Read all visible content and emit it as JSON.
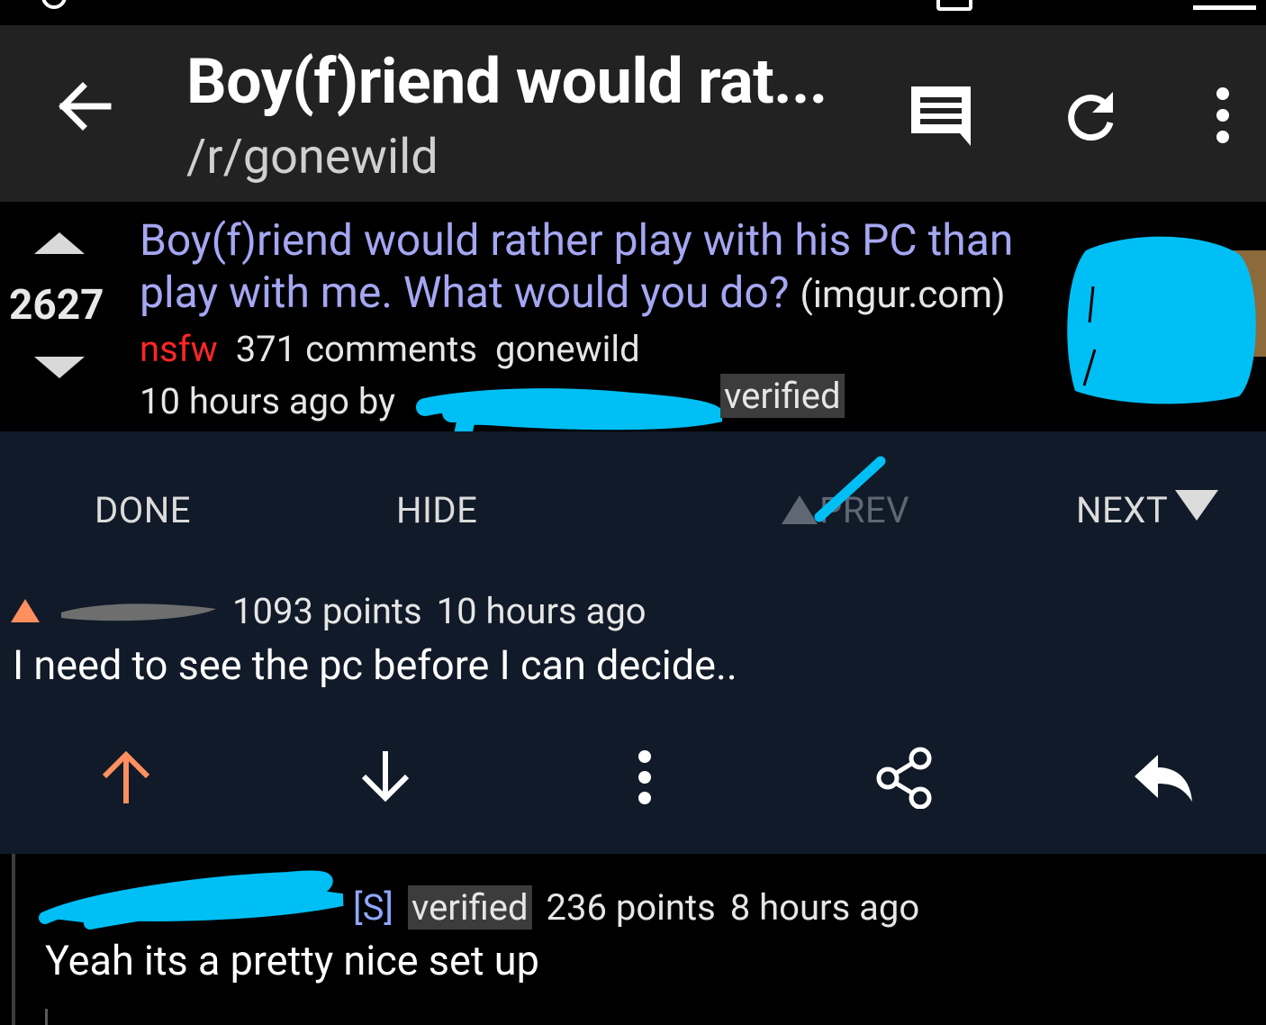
{
  "toolbar": {
    "title": "Boy(f)riend would rat...",
    "subreddit": "/r/gonewild",
    "icons": [
      "arrow-back-icon",
      "comments-icon",
      "refresh-icon",
      "overflow-menu-icon"
    ]
  },
  "post": {
    "score": "2627",
    "title": "Boy(f)riend would rather play with his PC than play with me. What would you do?",
    "domain": "(imgur.com)",
    "nsfw_label": "nsfw",
    "comments": "371 comments",
    "subreddit": "gonewild",
    "age": "10 hours ago by",
    "verified": "verified"
  },
  "navbar": {
    "done": "DONE",
    "hide": "HIDE",
    "prev": "PREV",
    "next": "NEXT"
  },
  "comment1": {
    "points": "1093 points",
    "age": "10 hours ago",
    "body": "I need to see the pc before I can decide.."
  },
  "comment2": {
    "submitter": "[S]",
    "verified": "verified",
    "points": "236 points",
    "age": "8 hours ago",
    "body": "Yeah its a pretty nice set up"
  },
  "colors": {
    "toolbar_bg": "#222222",
    "nav_bg": "#111a28",
    "title_link": "#a5a7f3",
    "nsfw": "#ff2626",
    "upvote_accent": "#ff8f5e",
    "redaction": "#00bff5"
  }
}
